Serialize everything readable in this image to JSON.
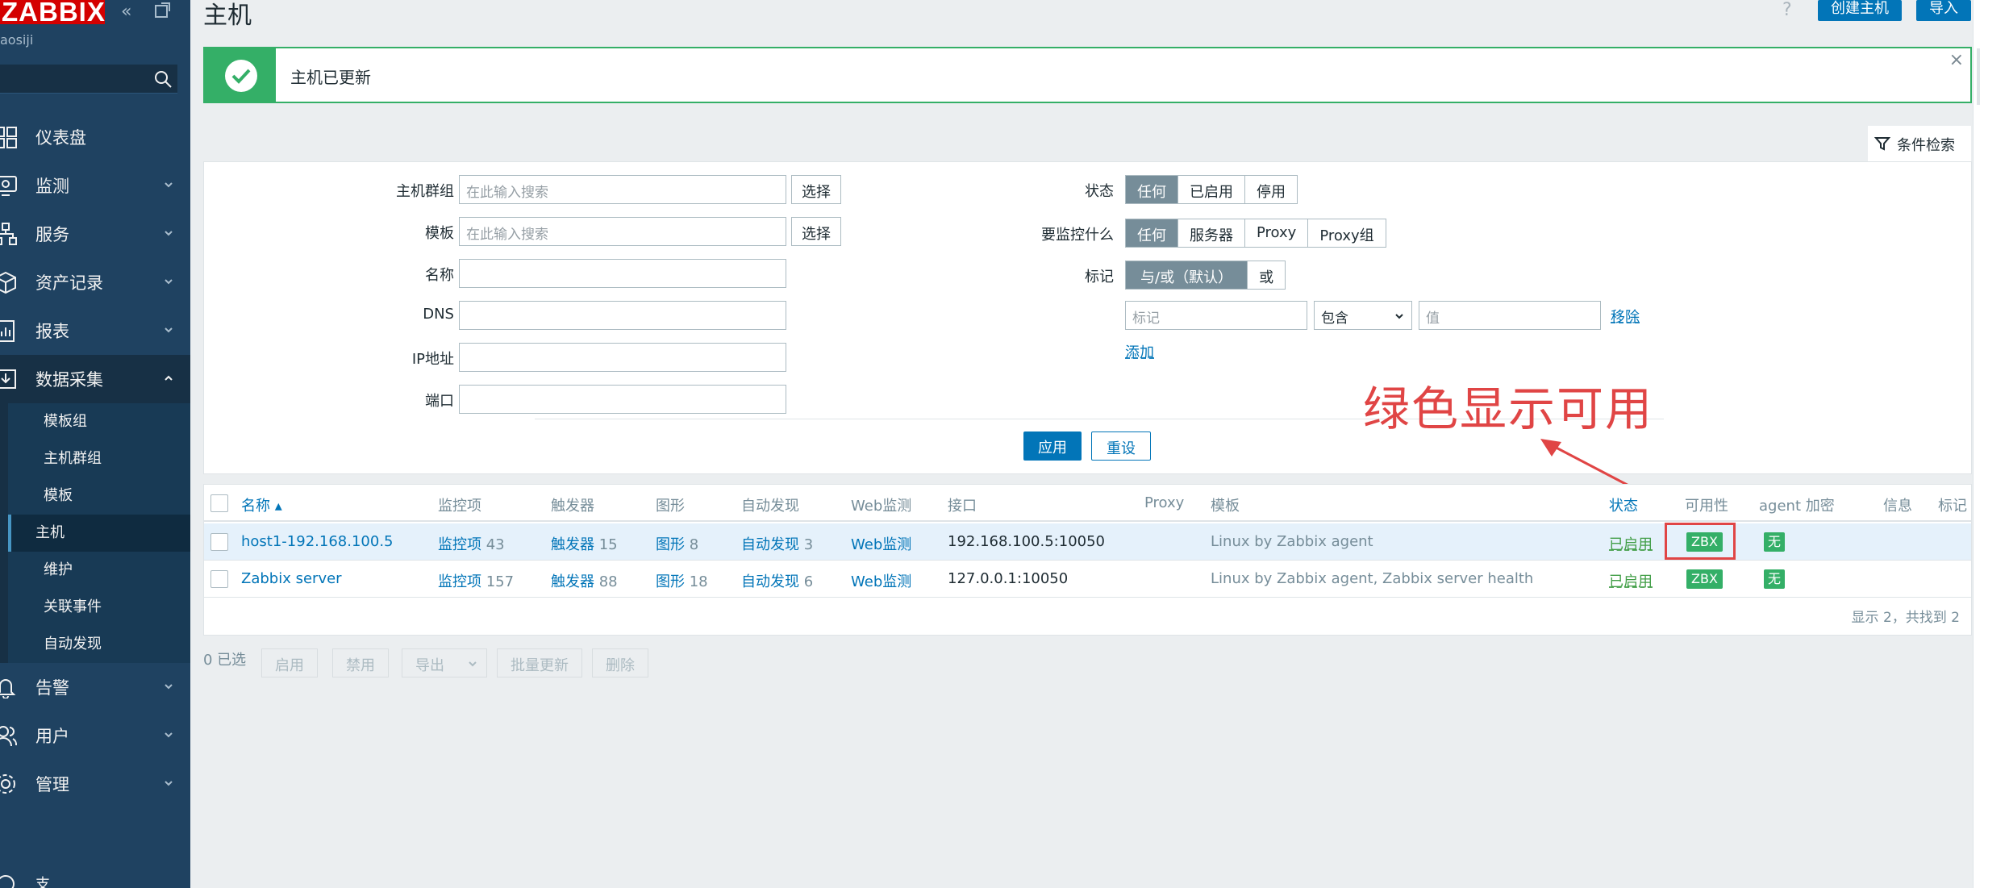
{
  "sidebar": {
    "logo": "ZABBIX",
    "server_name": "aosiji",
    "items": [
      {
        "label": "仪表盘"
      },
      {
        "label": "监测"
      },
      {
        "label": "服务"
      },
      {
        "label": "资产记录"
      },
      {
        "label": "报表"
      },
      {
        "label": "数据采集"
      },
      {
        "label": "告警"
      },
      {
        "label": "用户"
      },
      {
        "label": "管理"
      }
    ],
    "sub_items": [
      {
        "label": "模板组"
      },
      {
        "label": "主机群组"
      },
      {
        "label": "模板"
      },
      {
        "label": "主机"
      },
      {
        "label": "维护"
      },
      {
        "label": "关联事件"
      },
      {
        "label": "自动发现"
      }
    ],
    "support": "支持"
  },
  "header": {
    "title": "主机",
    "help": "?",
    "create_host": "创建主机",
    "import": "导入"
  },
  "message": {
    "text": "主机已更新",
    "close": "×"
  },
  "filter": {
    "tab_label": "条件检索",
    "host_groups_label": "主机群组",
    "host_groups_placeholder": "在此输入搜索",
    "templates_label": "模板",
    "templates_placeholder": "在此输入搜索",
    "select_label": "选择",
    "name_label": "名称",
    "dns_label": "DNS",
    "ip_label": "IP地址",
    "port_label": "端口",
    "status_label": "状态",
    "status_options": [
      "任何",
      "已启用",
      "停用"
    ],
    "monitored_label": "要监控什么",
    "monitored_options": [
      "任何",
      "服务器",
      "Proxy",
      "Proxy组"
    ],
    "tags_label": "标记",
    "tags_options": [
      "与/或（默认）",
      "或"
    ],
    "tag_placeholder": "标记",
    "tag_operator": "包含",
    "value_placeholder": "值",
    "remove": "移除",
    "add": "添加",
    "apply": "应用",
    "reset": "重设"
  },
  "annotation": "绿色显示可用",
  "table": {
    "headers": {
      "name": "名称 ▴",
      "items": "监控项",
      "triggers": "触发器",
      "graphs": "图形",
      "discovery": "自动发现",
      "web": "Web监测",
      "interface": "接口",
      "proxy": "Proxy",
      "templates": "模板",
      "status": "状态",
      "availability": "可用性",
      "encryption": "agent 加密",
      "info": "信息",
      "tags": "标记"
    },
    "rows": [
      {
        "name": "host1-192.168.100.5",
        "items_label": "监控项",
        "items_count": "43",
        "triggers_label": "触发器",
        "triggers_count": "15",
        "graphs_label": "图形",
        "graphs_count": "8",
        "discovery_label": "自动发现",
        "discovery_count": "3",
        "web": "Web监测",
        "interface": "192.168.100.5:10050",
        "templates": "Linux by Zabbix agent",
        "status": "已启用",
        "availability": "ZBX",
        "encryption": "无"
      },
      {
        "name": "Zabbix server",
        "items_label": "监控项",
        "items_count": "157",
        "triggers_label": "触发器",
        "triggers_count": "88",
        "graphs_label": "图形",
        "graphs_count": "18",
        "discovery_label": "自动发现",
        "discovery_count": "6",
        "web": "Web监测",
        "interface": "127.0.0.1:10050",
        "templates": "Linux by Zabbix agent, Zabbix server health",
        "status": "已启用",
        "availability": "ZBX",
        "encryption": "无"
      }
    ],
    "footer": "显示 2，共找到 2"
  },
  "bulk": {
    "selected": "0 已选",
    "enable": "启用",
    "disable": "禁用",
    "export": "导出",
    "mass_update": "批量更新",
    "delete": "删除"
  },
  "colors": {
    "sidebar": "#1f4261",
    "accent": "#0275b8",
    "success": "#34af67",
    "annotation": "#e04545"
  }
}
